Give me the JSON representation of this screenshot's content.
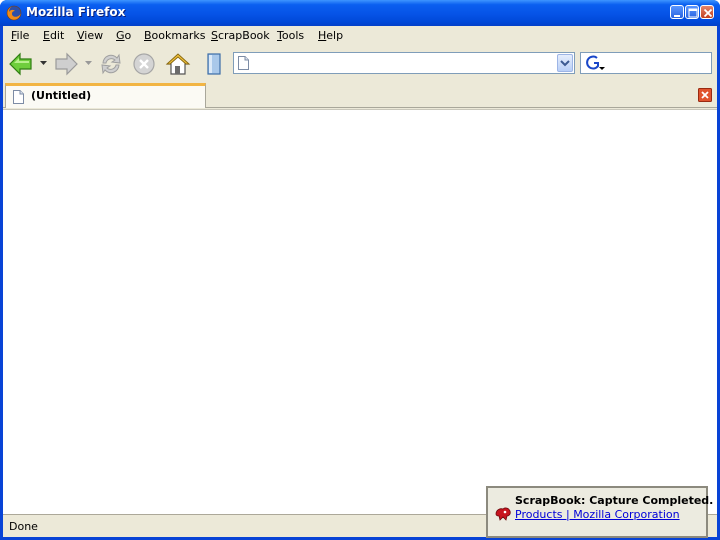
{
  "window": {
    "title": "Mozilla Firefox",
    "buttons": [
      "minimize",
      "maximize",
      "close"
    ]
  },
  "menubar": {
    "items": [
      {
        "accel": "F",
        "rest": "ile"
      },
      {
        "accel": "E",
        "rest": "dit"
      },
      {
        "accel": "V",
        "rest": "iew"
      },
      {
        "accel": "G",
        "rest": "o"
      },
      {
        "accel": "B",
        "rest": "ookmarks"
      },
      {
        "accel": "S",
        "rest": "crapBook"
      },
      {
        "accel": "T",
        "rest": "ools"
      },
      {
        "accel": "H",
        "rest": "elp"
      }
    ]
  },
  "navbar": {
    "icons": [
      "back-icon",
      "forward-icon",
      "reload-icon",
      "stop-icon",
      "home-icon",
      "scrapbook-sidebar-icon"
    ],
    "url_value": "",
    "search_value": "",
    "search_engine_icon": "google-icon"
  },
  "tabs": [
    {
      "label": "(Untitled)",
      "selected": true
    }
  ],
  "status": {
    "text": "Done"
  },
  "notification": {
    "title": "ScrapBook: Capture Completed.",
    "link": "Products | Mozilla Corporation"
  },
  "colors": {
    "titlebar": "#0653e6",
    "chrome": "#ece9d8",
    "tab_accent": "#f2b544",
    "link": "#0000d8"
  }
}
